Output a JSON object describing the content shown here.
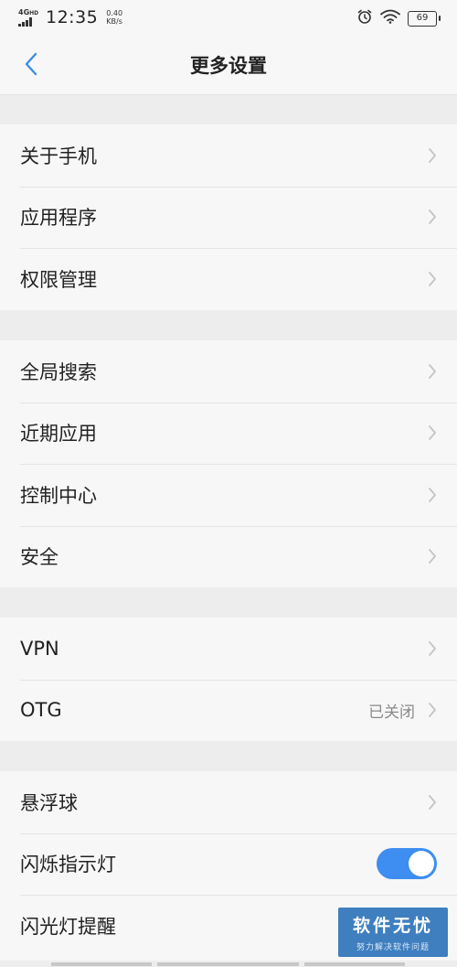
{
  "status_bar": {
    "network": "4G",
    "network_suffix": "HD",
    "time": "12:35",
    "speed_value": "0.40",
    "speed_unit": "KB/s",
    "battery": "69",
    "icons": [
      "alarm-icon",
      "wifi-icon",
      "battery-icon"
    ]
  },
  "header": {
    "title": "更多设置",
    "back_icon": "chevron-left-icon",
    "accent_color": "#3a8ee6"
  },
  "groups": [
    {
      "items": [
        {
          "label": "关于手机"
        },
        {
          "label": "应用程序"
        },
        {
          "label": "权限管理"
        }
      ]
    },
    {
      "items": [
        {
          "label": "全局搜索"
        },
        {
          "label": "近期应用"
        },
        {
          "label": "控制中心"
        },
        {
          "label": "安全"
        }
      ]
    },
    {
      "items": [
        {
          "label": "VPN"
        },
        {
          "label": "OTG",
          "value": "已关闭"
        }
      ]
    },
    {
      "items": [
        {
          "label": "悬浮球"
        },
        {
          "label": "闪烁指示灯",
          "toggle": "on"
        },
        {
          "label": "闪光灯提醒"
        }
      ]
    }
  ],
  "toggle_color": "#3d8ef0",
  "watermark": {
    "title": "软件无忧",
    "subtitle": "努力解决软件问题"
  }
}
